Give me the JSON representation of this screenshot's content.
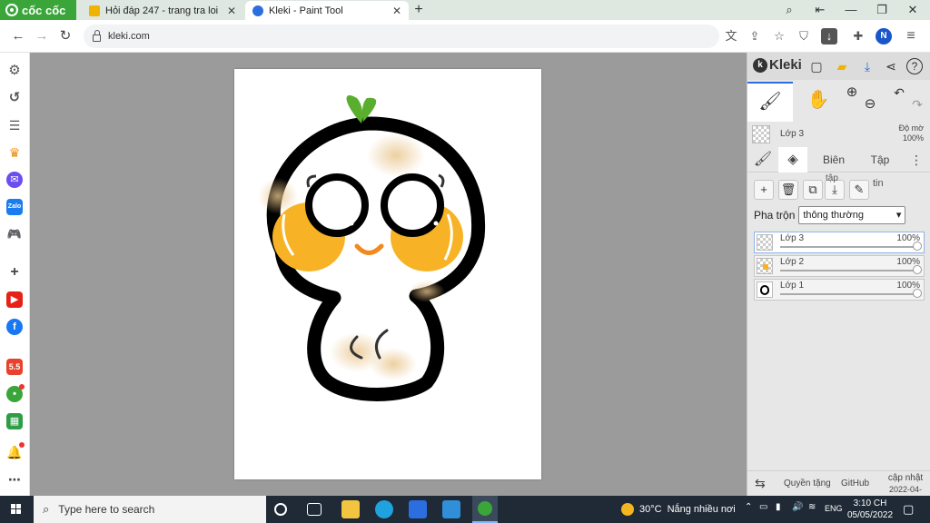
{
  "browser": {
    "brand": "cốc cốc",
    "tabs": [
      {
        "title": "Hỏi đáp 247 - trang tra loi",
        "favicon_color": "#f0b400"
      },
      {
        "title": "Kleki - Paint Tool",
        "favicon_color": "#2b6ee0"
      }
    ],
    "new_tab": "+",
    "url": "kleki.com",
    "avatar_letter": "N"
  },
  "kleki": {
    "logo": "Kleki",
    "layer_header": {
      "name": "Lớp 3",
      "opacity_label": "Độ mờ",
      "opacity_value": "100%"
    },
    "tabs": {
      "edit": "Biên",
      "edit_suffix": "tập",
      "file": "Tập",
      "file_suffix": "tin"
    },
    "blend_label": "Pha trộn",
    "blend_value": "thông thường",
    "layers": [
      {
        "name": "Lớp 3",
        "opacity": "100%",
        "selected": true
      },
      {
        "name": "Lớp 2",
        "opacity": "100%",
        "selected": false
      },
      {
        "name": "Lớp 1",
        "opacity": "100%",
        "selected": false
      }
    ],
    "footer": {
      "privacy": "Quyền tặng",
      "github": "GitHub",
      "update_label": "cập nhật",
      "update_date": "2022-04-30"
    }
  },
  "taskbar": {
    "search_placeholder": "Type here to search",
    "temperature": "30°C",
    "weather": "Nắng nhiều nơi",
    "language": "ENG",
    "time": "3:10 CH",
    "date": "05/05/2022"
  },
  "colors": {
    "brand_green": "#3aa63a",
    "accent_blue": "#2b6ee0",
    "cheek_orange": "#f7b325",
    "sprout_green": "#5aae2e",
    "taskbar": "#1f2a36"
  }
}
